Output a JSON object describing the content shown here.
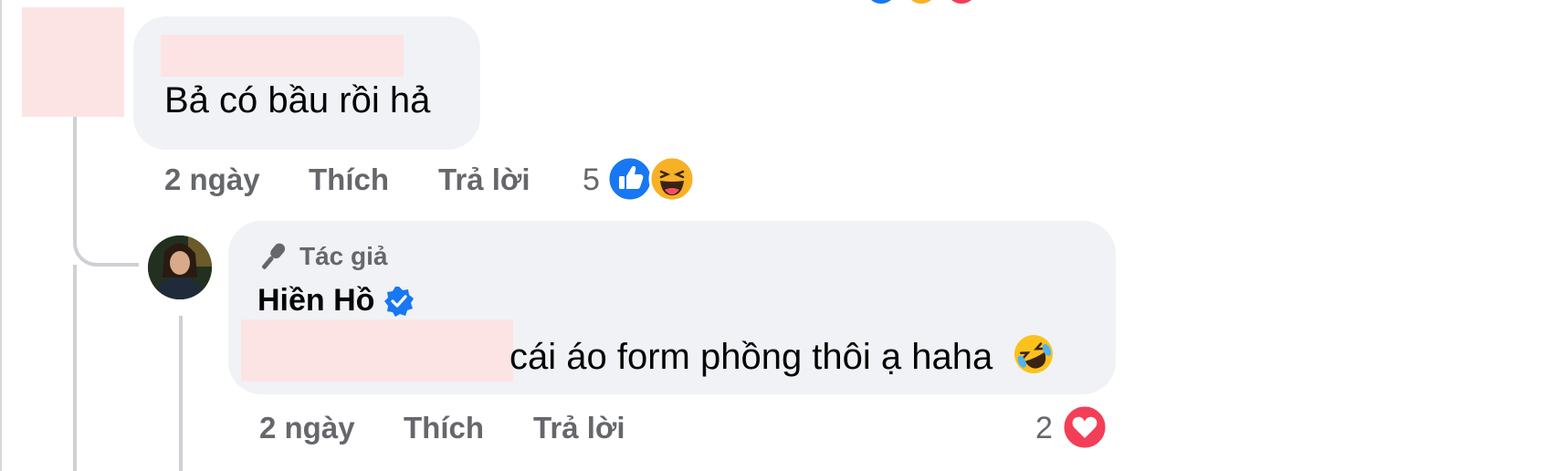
{
  "comment1": {
    "text": "Bả có bầu rồi hả",
    "time": "2 ngày",
    "like_label": "Thích",
    "reply_label": "Trả lời",
    "reaction_count": "5",
    "reaction_icons": [
      "like-icon",
      "haha-icon"
    ]
  },
  "comment2": {
    "author_badge": "Tác giả",
    "author_name": "Hiền Hồ",
    "text": "cái áo form phồng thôi ạ haha",
    "text_emoji": "rolling-on-floor-laughing-emoji",
    "time": "2 ngày",
    "like_label": "Thích",
    "reply_label": "Trả lời",
    "reaction_count": "2",
    "reaction_icons": [
      "love-icon"
    ]
  },
  "colors": {
    "bubble": "#f0f2f5",
    "meta_text": "#65676b",
    "like_blue": "#1877f2",
    "love_red": "#f33e58",
    "verified_blue": "#1877f2"
  }
}
